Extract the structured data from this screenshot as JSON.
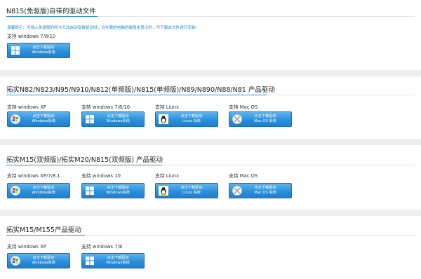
{
  "sections": [
    {
      "title": "N815(免驱版)自带的驱动文件",
      "notice": "温馨提示：当插入免驱版的网卡无法自动安装驱动时，且在我的电脑的磁盘未显示时，可下载此文件进行安装!",
      "items": [
        {
          "support": "支持 windows 7/8/10",
          "btn_line1": "点击下载驱动",
          "btn_line2": "Windows系统",
          "icon": "windows-icon"
        }
      ]
    },
    {
      "title": "拓实N82/N823/N95/N910/N812(单频版)/N815(单频版)/N89/N890/N88/N81 产品驱动",
      "items": [
        {
          "support": "支持 windows XP",
          "btn_line1": "点击下载驱动",
          "btn_line2": "Windows系统",
          "icon": "windows-xp-icon"
        },
        {
          "support": "支持 windows 7/8/10",
          "btn_line1": "点击下载驱动",
          "btn_line2": "Windows系统",
          "icon": "windows-icon"
        },
        {
          "support": "支持 Liunx",
          "btn_line1": "点击下载驱动",
          "btn_line2": "Linux 系统",
          "icon": "linux-penguin-icon"
        },
        {
          "support": "支持 Mac OS",
          "btn_line1": "点击下载驱动",
          "btn_line2": "Mac OS 系统",
          "icon": "mac-os-icon"
        }
      ]
    },
    {
      "title": "拓实M15(双频版)/拓实M20/N815(双频版) 产品驱动",
      "items": [
        {
          "support": "支持 windows XP/7/8.1",
          "btn_line1": "点击下载驱动",
          "btn_line2": "Windows系统",
          "icon": "windows-xp-icon"
        },
        {
          "support": "支持 windows 10",
          "btn_line1": "点击下载驱动",
          "btn_line2": "Windows系统",
          "icon": "windows-icon"
        },
        {
          "support": "支持 Liunx",
          "btn_line1": "点击下载驱动",
          "btn_line2": "Linux 系统",
          "icon": "linux-penguin-icon"
        },
        {
          "support": "支持 Mac OS",
          "btn_line1": "点击下载驱动",
          "btn_line2": "Mac OS 系统",
          "icon": "mac-os-icon"
        }
      ]
    },
    {
      "title": "拓实M15/M155产品驱动",
      "items": [
        {
          "support": "支持 windows XP",
          "btn_line1": "点击下载驱动",
          "btn_line2": "Windows系统",
          "icon": "windows-xp-icon"
        },
        {
          "support": "支持 windows 7/8",
          "btn_line1": "点击下载驱动",
          "btn_line2": "Windows系统",
          "icon": "windows-icon"
        }
      ]
    }
  ],
  "colors": {
    "accent": "#2d8fd6",
    "button": "#2b8fda",
    "notice": "#1a86d0",
    "background": "#eeeeee"
  }
}
